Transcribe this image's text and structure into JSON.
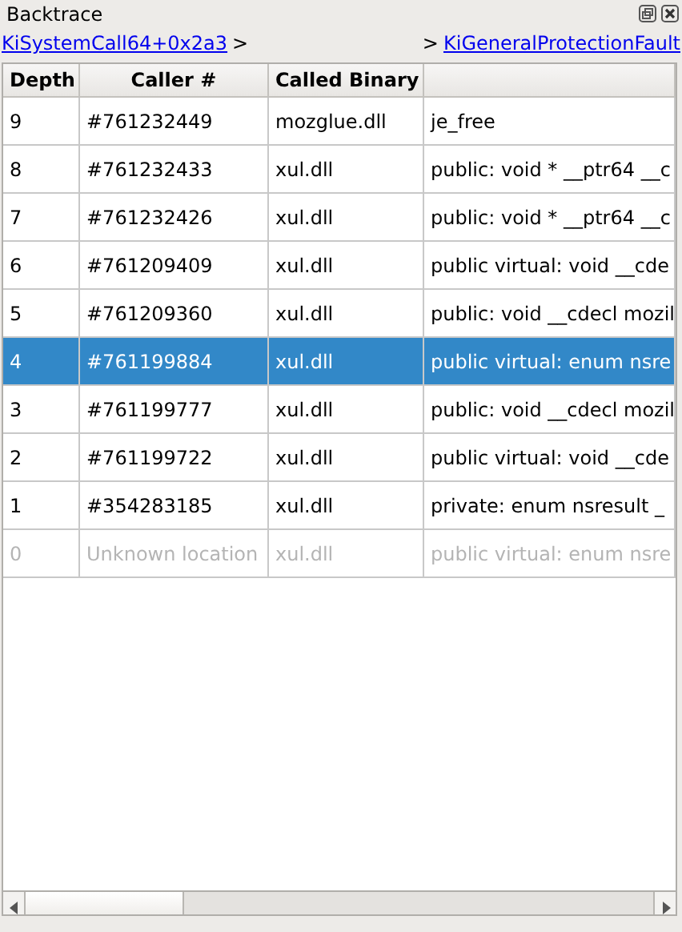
{
  "panel": {
    "title": "Backtrace"
  },
  "breadcrumb": {
    "left": "KiSystemCall64+0x2a3",
    "left_sep": ">",
    "right_sep": ">",
    "right": "KiGeneralProtectionFault"
  },
  "table": {
    "columns": [
      "Depth",
      "Caller #",
      "Called Binary"
    ],
    "rows": [
      {
        "depth": "9",
        "caller": "#761232449",
        "binary": "mozglue.dll",
        "function": "je_free",
        "selected": false,
        "disabled": false
      },
      {
        "depth": "8",
        "caller": "#761232433",
        "binary": "xul.dll",
        "function": "public: void * __ptr64 __c",
        "selected": false,
        "disabled": false
      },
      {
        "depth": "7",
        "caller": "#761232426",
        "binary": "xul.dll",
        "function": "public: void * __ptr64 __c",
        "selected": false,
        "disabled": false
      },
      {
        "depth": "6",
        "caller": "#761209409",
        "binary": "xul.dll",
        "function": "public virtual: void __cde",
        "selected": false,
        "disabled": false
      },
      {
        "depth": "5",
        "caller": "#761209360",
        "binary": "xul.dll",
        "function": "public: void __cdecl mozil",
        "selected": false,
        "disabled": false
      },
      {
        "depth": "4",
        "caller": "#761199884",
        "binary": "xul.dll",
        "function": "public virtual: enum nsre",
        "selected": true,
        "disabled": false
      },
      {
        "depth": "3",
        "caller": "#761199777",
        "binary": "xul.dll",
        "function": "public: void __cdecl mozil",
        "selected": false,
        "disabled": false
      },
      {
        "depth": "2",
        "caller": "#761199722",
        "binary": "xul.dll",
        "function": "public virtual: void __cde",
        "selected": false,
        "disabled": false
      },
      {
        "depth": "1",
        "caller": "#354283185",
        "binary": "xul.dll",
        "function": "private: enum nsresult _",
        "selected": false,
        "disabled": false
      },
      {
        "depth": "0",
        "caller": "Unknown location",
        "binary": "xul.dll",
        "function": "public virtual: enum nsre",
        "selected": false,
        "disabled": true
      }
    ]
  }
}
